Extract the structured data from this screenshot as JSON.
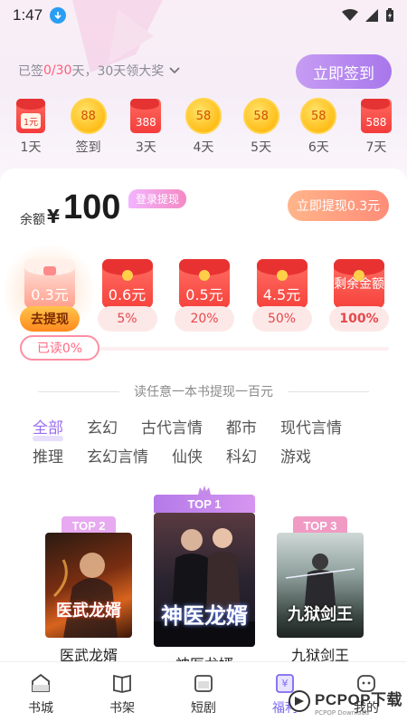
{
  "status_bar": {
    "time": "1:47"
  },
  "signin": {
    "prefix": "已签 ",
    "progress": "0/30",
    "suffix": " 天，30天领大奖",
    "button": "立即签到",
    "days": [
      {
        "kind": "envelope",
        "value": "1元",
        "label": "1天"
      },
      {
        "kind": "coin",
        "value": "88",
        "label": "签到"
      },
      {
        "kind": "envelope",
        "value": "388",
        "label": "3天"
      },
      {
        "kind": "coin",
        "value": "58",
        "label": "4天"
      },
      {
        "kind": "coin",
        "value": "58",
        "label": "5天"
      },
      {
        "kind": "coin",
        "value": "58",
        "label": "6天"
      },
      {
        "kind": "envelope",
        "value": "588",
        "label": "7天"
      }
    ]
  },
  "balance": {
    "label": "余额",
    "currency": "¥",
    "amount": "100",
    "login_tag": "登录提现",
    "withdraw_button": "立即提现0.3元"
  },
  "tiers": [
    {
      "amount": "0.3元",
      "pct": "去提现"
    },
    {
      "amount": "0.6元",
      "pct": "5%"
    },
    {
      "amount": "0.5元",
      "pct": "20%"
    },
    {
      "amount": "4.5元",
      "pct": "50%"
    },
    {
      "amount": "剩余金额",
      "pct": "100%"
    }
  ],
  "read_progress": {
    "label": "已读0%",
    "fraction": 0
  },
  "headline": "读任意一本书提现一百元",
  "categories": {
    "row1": [
      "全部",
      "玄幻",
      "古代言情",
      "都市",
      "现代言情"
    ],
    "row2": [
      "推理",
      "玄幻言情",
      "仙侠",
      "科幻",
      "游戏"
    ],
    "active": "全部"
  },
  "books": [
    {
      "rank": "TOP 2",
      "title": "医武龙婿",
      "cover_text": "医武龙婿"
    },
    {
      "rank": "TOP 1",
      "title": "神医龙婿",
      "cover_text": "神医龙婿"
    },
    {
      "rank": "TOP 3",
      "title": "九狱剑王",
      "cover_text": "九狱剑王"
    }
  ],
  "nav": [
    {
      "label": "书城",
      "icon": "bookstore-icon"
    },
    {
      "label": "书架",
      "icon": "bookshelf-icon"
    },
    {
      "label": "短剧",
      "icon": "short-drama-icon"
    },
    {
      "label": "福利",
      "icon": "welfare-icon"
    },
    {
      "label": "我的",
      "icon": "profile-icon"
    }
  ],
  "watermark": {
    "brand": "PCPOP下载",
    "sub": "PCPOP Download"
  },
  "colors": {
    "accent": "#9a6ef0",
    "red": "#f43c3c",
    "signin_btn": "#b283ef"
  }
}
